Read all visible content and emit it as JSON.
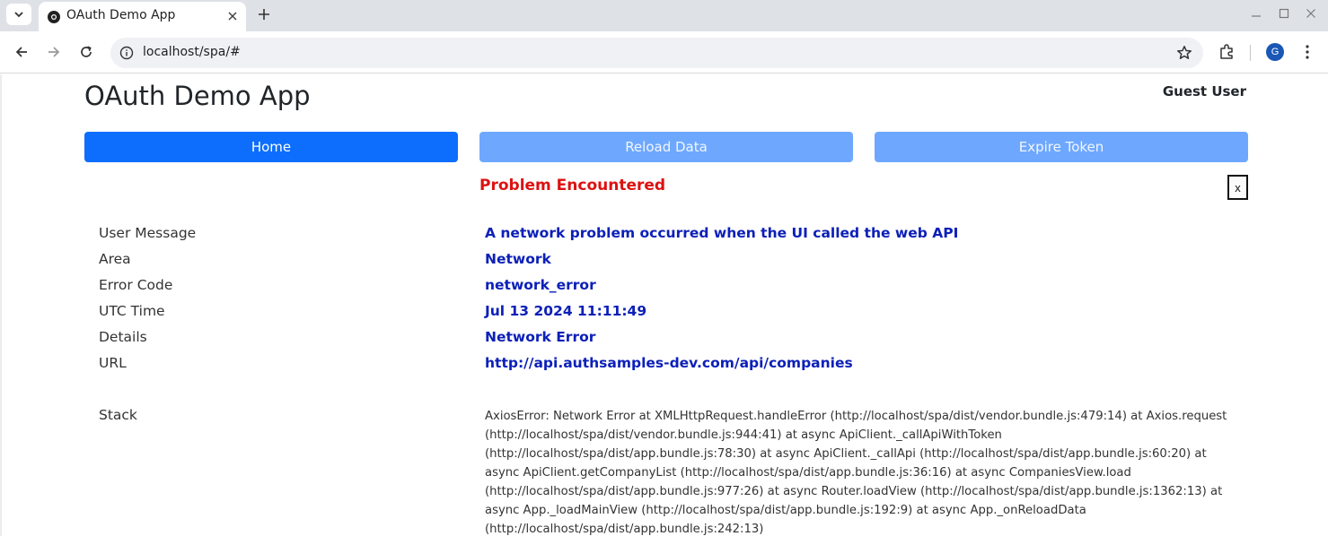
{
  "browser": {
    "tab_title": "OAuth Demo App",
    "url": "localhost/spa/#",
    "profile_initial": "G",
    "icons": [
      "tab-search-icon",
      "chrome-favicon-icon",
      "close-icon",
      "plus-icon",
      "minimize-icon",
      "maximize-icon",
      "window-close-icon",
      "back-arrow-icon",
      "forward-arrow-icon",
      "reload-icon",
      "info-icon",
      "star-icon",
      "extensions-icon",
      "kebab-menu-icon"
    ]
  },
  "app": {
    "title": "OAuth Demo App",
    "user": "Guest User"
  },
  "buttons": {
    "home": "Home",
    "reload": "Reload Data",
    "expire": "Expire Token"
  },
  "error": {
    "heading": "Problem Encountered",
    "close_label": "x",
    "rows": [
      {
        "label": "User Message",
        "value": "A network problem occurred when the UI called the web API"
      },
      {
        "label": "Area",
        "value": "Network"
      },
      {
        "label": "Error Code",
        "value": "network_error"
      },
      {
        "label": "UTC Time",
        "value": "Jul 13 2024 11:11:49"
      },
      {
        "label": "Details",
        "value": "Network Error"
      },
      {
        "label": "URL",
        "value": "http://api.authsamples-dev.com/api/companies"
      }
    ],
    "stack_label": "Stack",
    "stack_text": "AxiosError: Network Error at XMLHttpRequest.handleError (http://localhost/spa/dist/vendor.bundle.js:479:14) at Axios.request (http://localhost/spa/dist/vendor.bundle.js:944:41) at async ApiClient._callApiWithToken (http://localhost/spa/dist/app.bundle.js:78:30) at async ApiClient._callApi (http://localhost/spa/dist/app.bundle.js:60:20) at async ApiClient.getCompanyList (http://localhost/spa/dist/app.bundle.js:36:16) at async CompaniesView.load (http://localhost/spa/dist/app.bundle.js:977:26) at async Router.loadView (http://localhost/spa/dist/app.bundle.js:1362:13) at async App._loadMainView (http://localhost/spa/dist/app.bundle.js:192:9) at async App._onReloadData (http://localhost/spa/dist/app.bundle.js:242:13)"
  },
  "colors": {
    "primary": "#0d6efd",
    "disabled_button": "#6ea8fe",
    "error_heading": "#dd1111",
    "value_text": "#0c20b8"
  }
}
